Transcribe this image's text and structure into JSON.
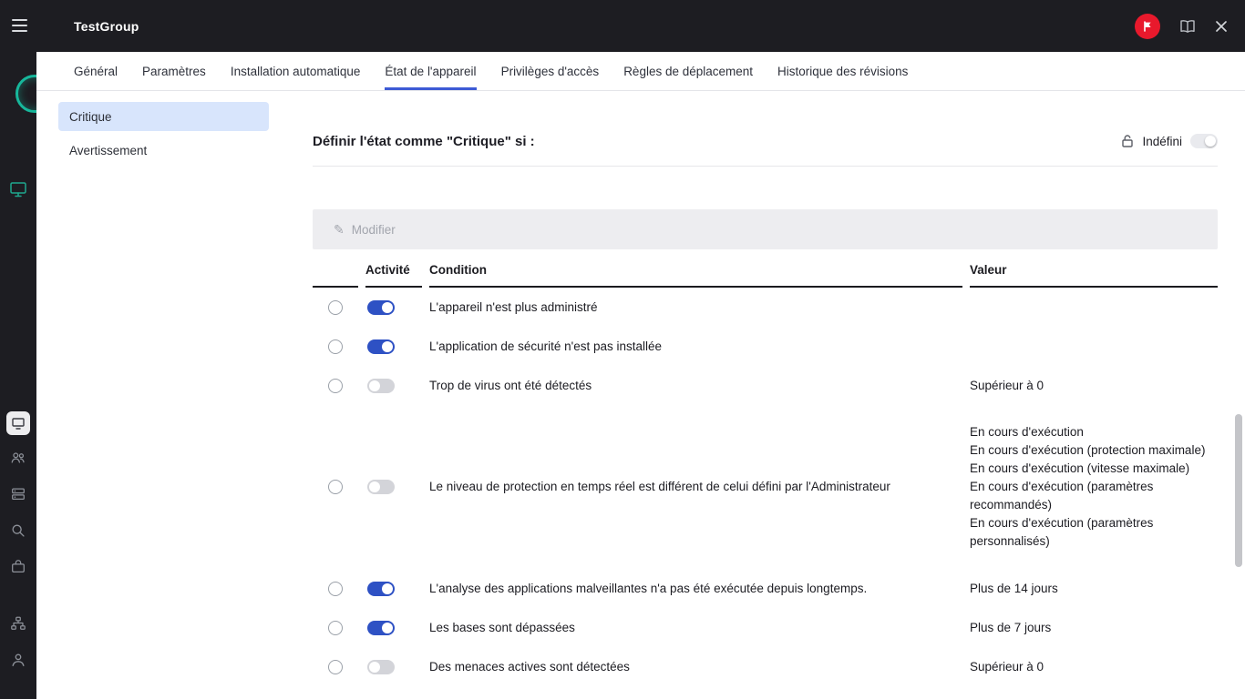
{
  "topbar": {
    "title": "TestGroup",
    "icons": {
      "menu": "hamburger-menu-icon",
      "support_badge": "flag-badge-icon",
      "documentation": "book-icon",
      "close": "close-icon"
    }
  },
  "rail_icons": [
    "logo-ring-icon",
    "devices-monitor-icon",
    "active-section-icon",
    "users-icon",
    "servers-icon",
    "search-icon",
    "bag-icon",
    "hierarchy-icon",
    "account-icon"
  ],
  "tabs": {
    "active_index": 3,
    "items": [
      "Général",
      "Paramètres",
      "Installation automatique",
      "État de l'appareil",
      "Privilèges d'accès",
      "Règles de déplacement",
      "Historique des révisions"
    ]
  },
  "side_nav": {
    "active_index": 0,
    "items": [
      "Critique",
      "Avertissement"
    ]
  },
  "main": {
    "heading": "Définir l'état comme \"Critique\" si :",
    "undefined_toggle": {
      "label": "Indéfini",
      "on": true
    },
    "toolbar": {
      "modify_label": "Modifier",
      "enabled": false
    },
    "table": {
      "headers": {
        "activity": "Activité",
        "condition": "Condition",
        "value": "Valeur"
      },
      "rows": [
        {
          "enabled": true,
          "condition": "L'appareil n'est plus administré",
          "value": ""
        },
        {
          "enabled": true,
          "condition": "L'application de sécurité n'est pas installée",
          "value": ""
        },
        {
          "enabled": false,
          "condition": "Trop de virus ont été détectés",
          "value": "Supérieur à 0"
        },
        {
          "enabled": false,
          "condition": "Le niveau de protection en temps réel est différent de celui défini par l'Administrateur",
          "value_lines": [
            "En cours d'exécution",
            "En cours d'exécution (protection maximale)",
            "En cours d'exécution (vitesse maximale)",
            "En cours d'exécution (paramètres recommandés)",
            "En cours d'exécution (paramètres personnalisés)"
          ]
        },
        {
          "enabled": true,
          "condition": "L'analyse des applications malveillantes n'a pas été exécutée depuis longtemps.",
          "value": "Plus de 14 jours"
        },
        {
          "enabled": true,
          "condition": "Les bases sont dépassées",
          "value": "Plus de 7 jours"
        },
        {
          "enabled": false,
          "condition": "Des menaces actives sont détectées",
          "value": "Supérieur à 0"
        }
      ]
    }
  },
  "colors": {
    "accent": "#3d5ad5",
    "toggle_on": "#2e51c4",
    "toggle_off": "#d3d4d9",
    "selected_bg": "#d8e5fc",
    "badge_red": "#e8192c",
    "dark": "#1d1d22"
  }
}
